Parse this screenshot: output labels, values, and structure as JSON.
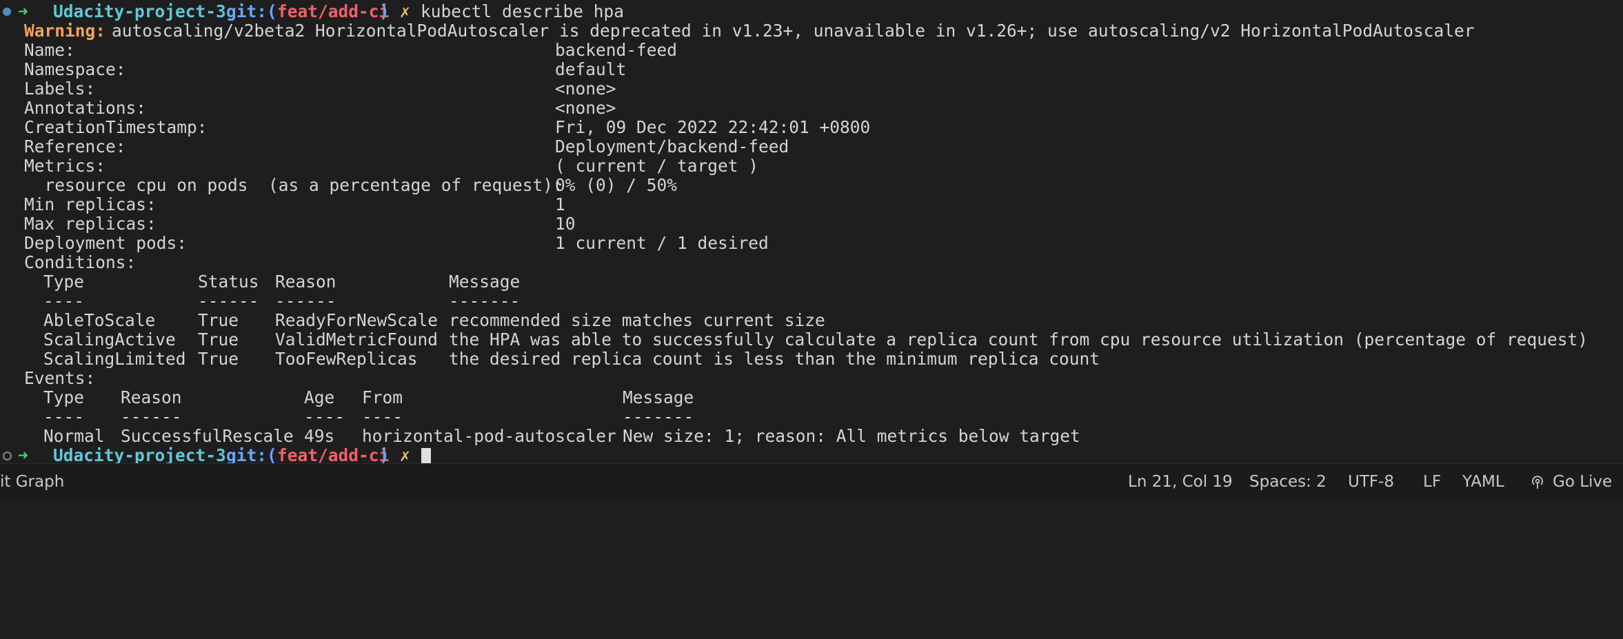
{
  "prompt": {
    "arrow": "➜",
    "dir": "Udacity-project-3",
    "git_label": "git:(",
    "branch": "feat/add-ci",
    "git_close": ")",
    "dirty_mark": "✗",
    "command": "kubectl describe hpa"
  },
  "warning": {
    "label": "Warning:",
    "text": "autoscaling/v2beta2 HorizontalPodAutoscaler is deprecated in v1.23+, unavailable in v1.26+; use autoscaling/v2 HorizontalPodAutoscaler"
  },
  "fields": [
    {
      "key": "Name:",
      "value": "backend-feed"
    },
    {
      "key": "Namespace:",
      "value": "default"
    },
    {
      "key": "Labels:",
      "value": "<none>"
    },
    {
      "key": "Annotations:",
      "value": "<none>"
    },
    {
      "key": "CreationTimestamp:",
      "value": "Fri, 09 Dec 2022 22:42:01 +0800"
    },
    {
      "key": "Reference:",
      "value": "Deployment/backend-feed"
    },
    {
      "key": "Metrics:",
      "value": "( current / target )"
    },
    {
      "key": "  resource cpu on pods  (as a percentage of request):",
      "value": "0% (0) / 50%"
    },
    {
      "key": "Min replicas:",
      "value": "1"
    },
    {
      "key": "Max replicas:",
      "value": "10"
    },
    {
      "key": "Deployment pods:",
      "value": "1 current / 1 desired"
    }
  ],
  "conditions": {
    "label": "Conditions:",
    "headers": [
      "Type",
      "Status",
      "Reason",
      "Message"
    ],
    "dashes": [
      "----",
      "------",
      "------",
      "-------"
    ],
    "rows": [
      [
        "AbleToScale",
        "True",
        "ReadyForNewScale",
        "recommended size matches current size"
      ],
      [
        "ScalingActive",
        "True",
        "ValidMetricFound",
        "the HPA was able to successfully calculate a replica count from cpu resource utilization (percentage of request)"
      ],
      [
        "ScalingLimited",
        "True",
        "TooFewReplicas",
        "the desired replica count is less than the minimum replica count"
      ]
    ]
  },
  "events": {
    "label": "Events:",
    "headers": [
      "Type",
      "Reason",
      "Age",
      "From",
      "Message"
    ],
    "dashes": [
      "----",
      "------",
      "----",
      "----",
      "-------"
    ],
    "rows": [
      [
        "Normal",
        "SuccessfulRescale",
        "49s",
        "horizontal-pod-autoscaler",
        "New size: 1; reason: All metrics below target"
      ]
    ]
  },
  "statusbar": {
    "left": "it Graph",
    "position": "Ln 21, Col 19",
    "spaces": "Spaces: 2",
    "encoding": "UTF-8",
    "eol": "LF",
    "language": "YAML",
    "golive": "Go Live"
  }
}
